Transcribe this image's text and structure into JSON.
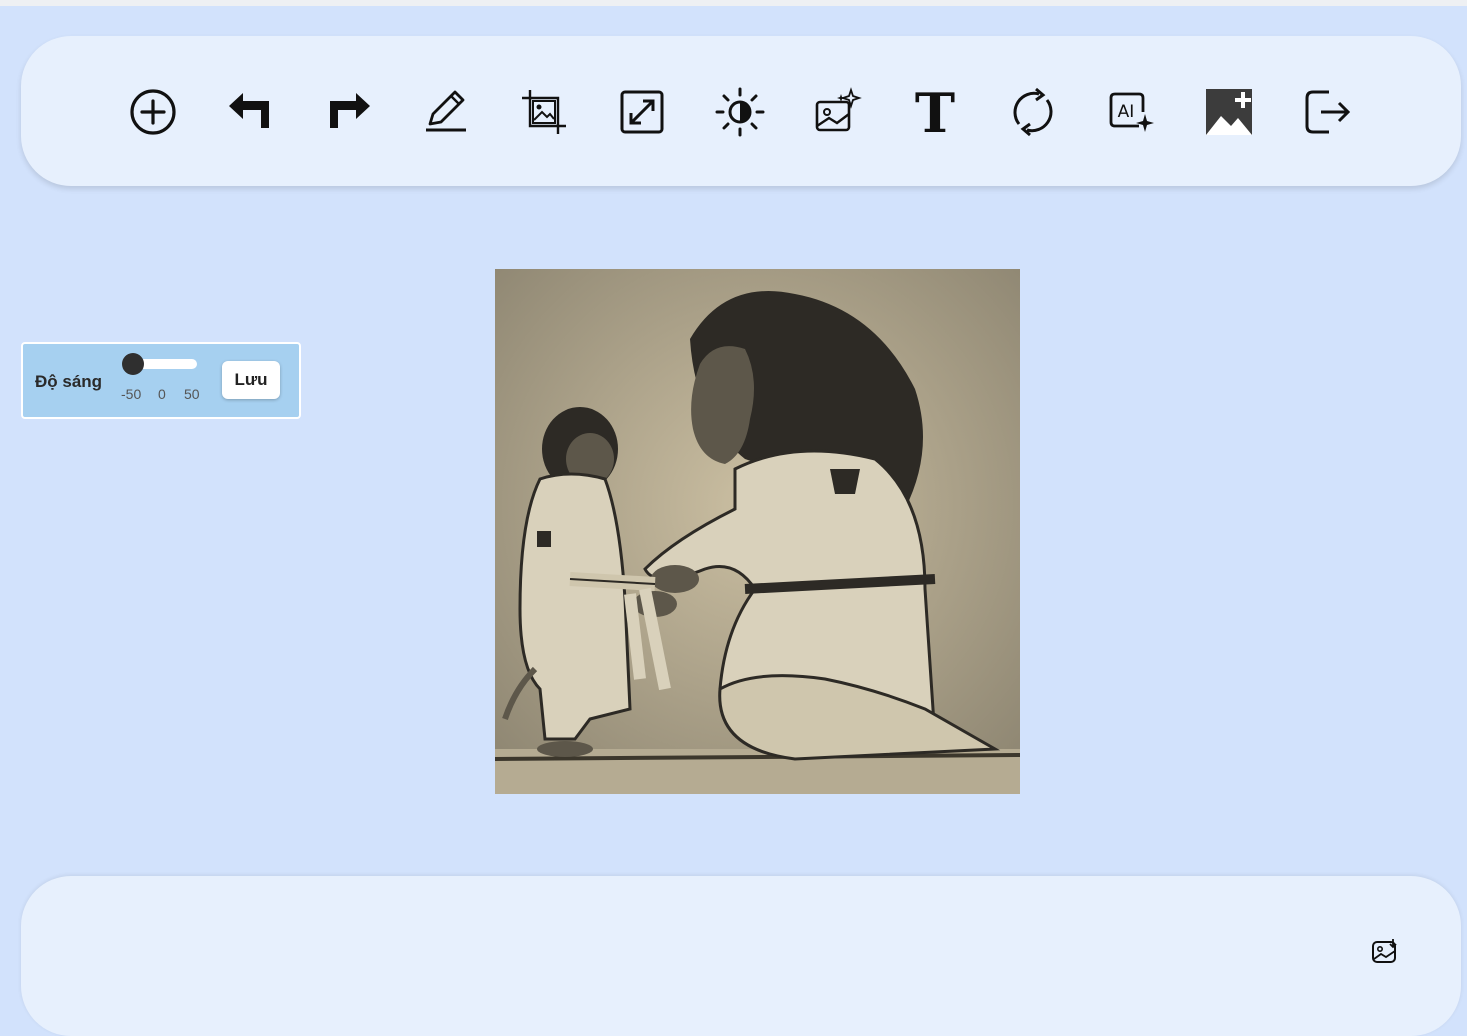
{
  "toolbar": {
    "tools": [
      {
        "name": "add-circle-icon"
      },
      {
        "name": "undo-icon"
      },
      {
        "name": "redo-icon"
      },
      {
        "name": "pencil-icon"
      },
      {
        "name": "crop-icon"
      },
      {
        "name": "resize-expand-icon"
      },
      {
        "name": "brightness-icon"
      },
      {
        "name": "image-filter-icon"
      },
      {
        "name": "text-icon"
      },
      {
        "name": "rotate-icon"
      },
      {
        "name": "ai-icon"
      },
      {
        "name": "add-image-icon"
      },
      {
        "name": "exit-icon"
      }
    ]
  },
  "brightness": {
    "label": "Độ sáng",
    "value_min_label": "-50",
    "value_mid_label": "0",
    "value_max_label": "50",
    "value": -50,
    "save_label": "Lưu"
  },
  "bottom": {
    "download_icon": "image-download-icon"
  },
  "colors": {
    "background": "#d2e2fc",
    "bar": "#e7f0fd",
    "panel": "#a6d0f0"
  }
}
